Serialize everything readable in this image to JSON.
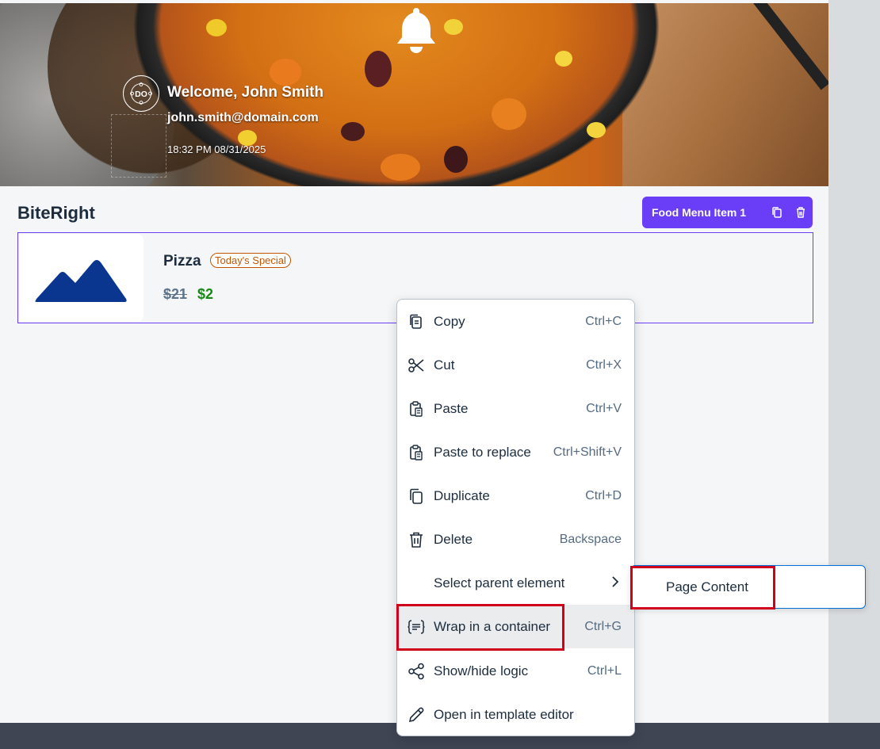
{
  "header": {
    "welcome": "Welcome, John Smith",
    "email": "john.smith@domain.com",
    "datetime": "18:32 PM 08/31/2025"
  },
  "page": {
    "brand": "BiteRight"
  },
  "selection": {
    "label": "Food Menu Item 1",
    "actions": [
      "copy-icon",
      "trash-icon"
    ],
    "color": "#6a3df7"
  },
  "card": {
    "name": "Pizza",
    "badge": "Today's Special",
    "old_price": "$21",
    "new_price": "$2"
  },
  "context_menu": {
    "items": [
      {
        "label": "Copy",
        "shortcut": "Ctrl+C",
        "icon": "copy-icon"
      },
      {
        "label": "Cut",
        "shortcut": "Ctrl+X",
        "icon": "scissors-icon"
      },
      {
        "label": "Paste",
        "shortcut": "Ctrl+V",
        "icon": "paste-icon"
      },
      {
        "label": "Paste to replace",
        "shortcut": "Ctrl+Shift+V",
        "icon": "paste-replace-icon"
      },
      {
        "label": "Duplicate",
        "shortcut": "Ctrl+D",
        "icon": "duplicate-icon"
      },
      {
        "label": "Delete",
        "shortcut": "Backspace",
        "icon": "trash-icon"
      },
      {
        "label": "Select parent element",
        "shortcut": "",
        "icon": "chevron-right-icon"
      },
      {
        "label": "Wrap in a container",
        "shortcut": "Ctrl+G",
        "icon": "container-icon"
      },
      {
        "label": "Show/hide logic",
        "shortcut": "Ctrl+L",
        "icon": "share-icon"
      },
      {
        "label": "Open in template editor",
        "shortcut": "",
        "icon": "pencil-icon"
      }
    ],
    "highlight_color": "#d0021b"
  },
  "submenu": {
    "items": [
      {
        "label": "Page Content"
      }
    ]
  }
}
